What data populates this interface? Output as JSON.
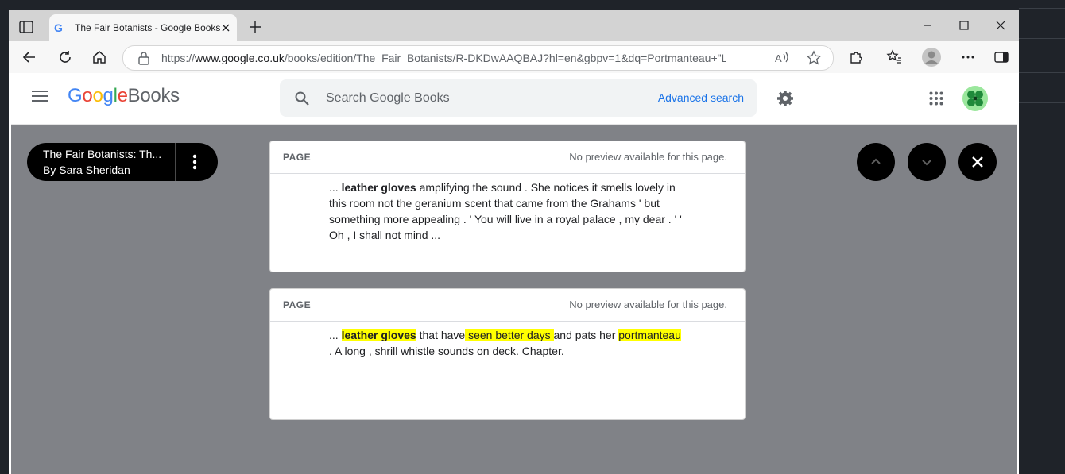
{
  "browser": {
    "tab_title": "The Fair Botanists - Google Books",
    "favicon_letter": "G",
    "url_prefix": "https://",
    "url_domain": "www.google.co.uk",
    "url_rest": "/books/edition/The_Fair_Botanists/R-DKDwAAQBAJ?hl=en&gbpv=1&dq=Portmanteau+\"Leath..."
  },
  "header": {
    "logo_google": [
      "G",
      "o",
      "o",
      "g",
      "l",
      "e"
    ],
    "logo_books": "Books",
    "search_placeholder": "Search Google Books",
    "advanced_search": "Advanced search"
  },
  "book": {
    "title": "The Fair Botanists: Th...",
    "author": "By Sara Sheridan"
  },
  "results": [
    {
      "kind": "PAGE",
      "note": "No preview available for this page.",
      "snippet": {
        "prefix": "... ",
        "bold": "leather gloves",
        "rest": " amplifying the sound . She notices it smells lovely in this room not the geranium scent that came from the Grahams ' but something more appealing . ' You will live in a royal palace , my dear . ' ' Oh , I shall not mind ..."
      }
    },
    {
      "kind": "PAGE",
      "note": "No preview available for this page.",
      "snippet": {
        "prefix": "... ",
        "bold": "leather gloves",
        "mid1": " that have",
        "hl1": " seen better days ",
        "mid2": "and pats her ",
        "hl2": "portmanteau ",
        "rest": ". A long , shrill whistle sounds on deck. Chapter."
      }
    }
  ],
  "colors": {
    "content_bg": "#808287",
    "highlight": "#ffff00",
    "link": "#1a73e8"
  }
}
